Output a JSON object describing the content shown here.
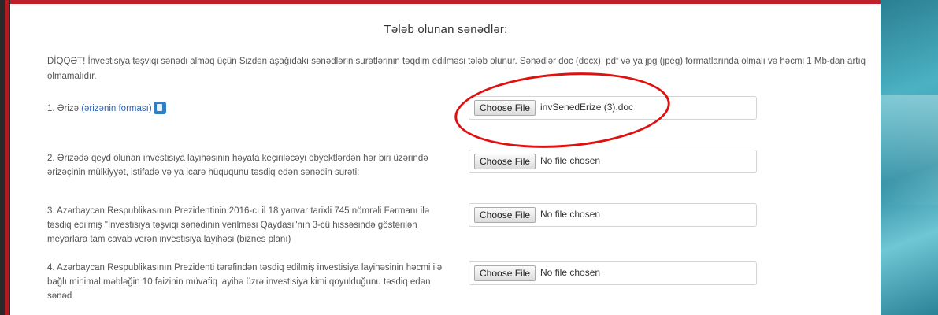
{
  "page": {
    "title": "Tələb olunan sənədlər:",
    "notice": "DİQQƏT! İnvestisiya təşviqi sənədi almaq üçün Sizdən aşağıdakı sənədlərin surətlərinin təqdim edilməsi tələb olunur. Sənədlər doc (docx), pdf və ya jpg (jpeg) formatlarında olmalı və həcmi 1 Mb-dan artıq olmamalıdır."
  },
  "documents": [
    {
      "label": "1. Ərizə",
      "link": "(ərizənin forması)",
      "button": "Choose File",
      "file": "invSenedErize (3).doc"
    },
    {
      "label": "2. Ərizədə qeyd olunan investisiya layihəsinin həyata keçiriləcəyi obyektlərdən hər biri üzərində ərizəçinin mülkiyyət, istifadə və ya icarə hüququnu təsdiq edən sənədin surəti:",
      "button": "Choose File",
      "file": "No file chosen"
    },
    {
      "label": "3. Azərbaycan Respublikasının Prezidentinin 2016-cı il 18 yanvar tarixli 745 nömrəli Fərmanı ilə təsdiq edilmiş \"İnvestisiya təşviqi sənədinin verilməsi Qaydası\"nın 3-cü hissəsində göstərilən meyarlara tam cavab verən investisiya layihəsi (biznes planı)",
      "button": "Choose File",
      "file": "No file chosen"
    },
    {
      "label": "4. Azərbaycan Respublikasının Prezidenti tərəfindən təsdiq edilmiş investisiya layihəsinin həcmi ilə bağlı minimal məbləğin 10 faizinin müvafiq layihə üzrə investisiya kimi qoyulduğunu təsdiq edən sənəd",
      "button": "Choose File",
      "file": "No file chosen"
    }
  ],
  "colors": {
    "link": "#2b63b5",
    "annotation": "#e01010",
    "top_border": "#c0202a",
    "side_panel": "#3aa0b4"
  },
  "icons": {
    "doc_link_icon": "document-icon"
  }
}
